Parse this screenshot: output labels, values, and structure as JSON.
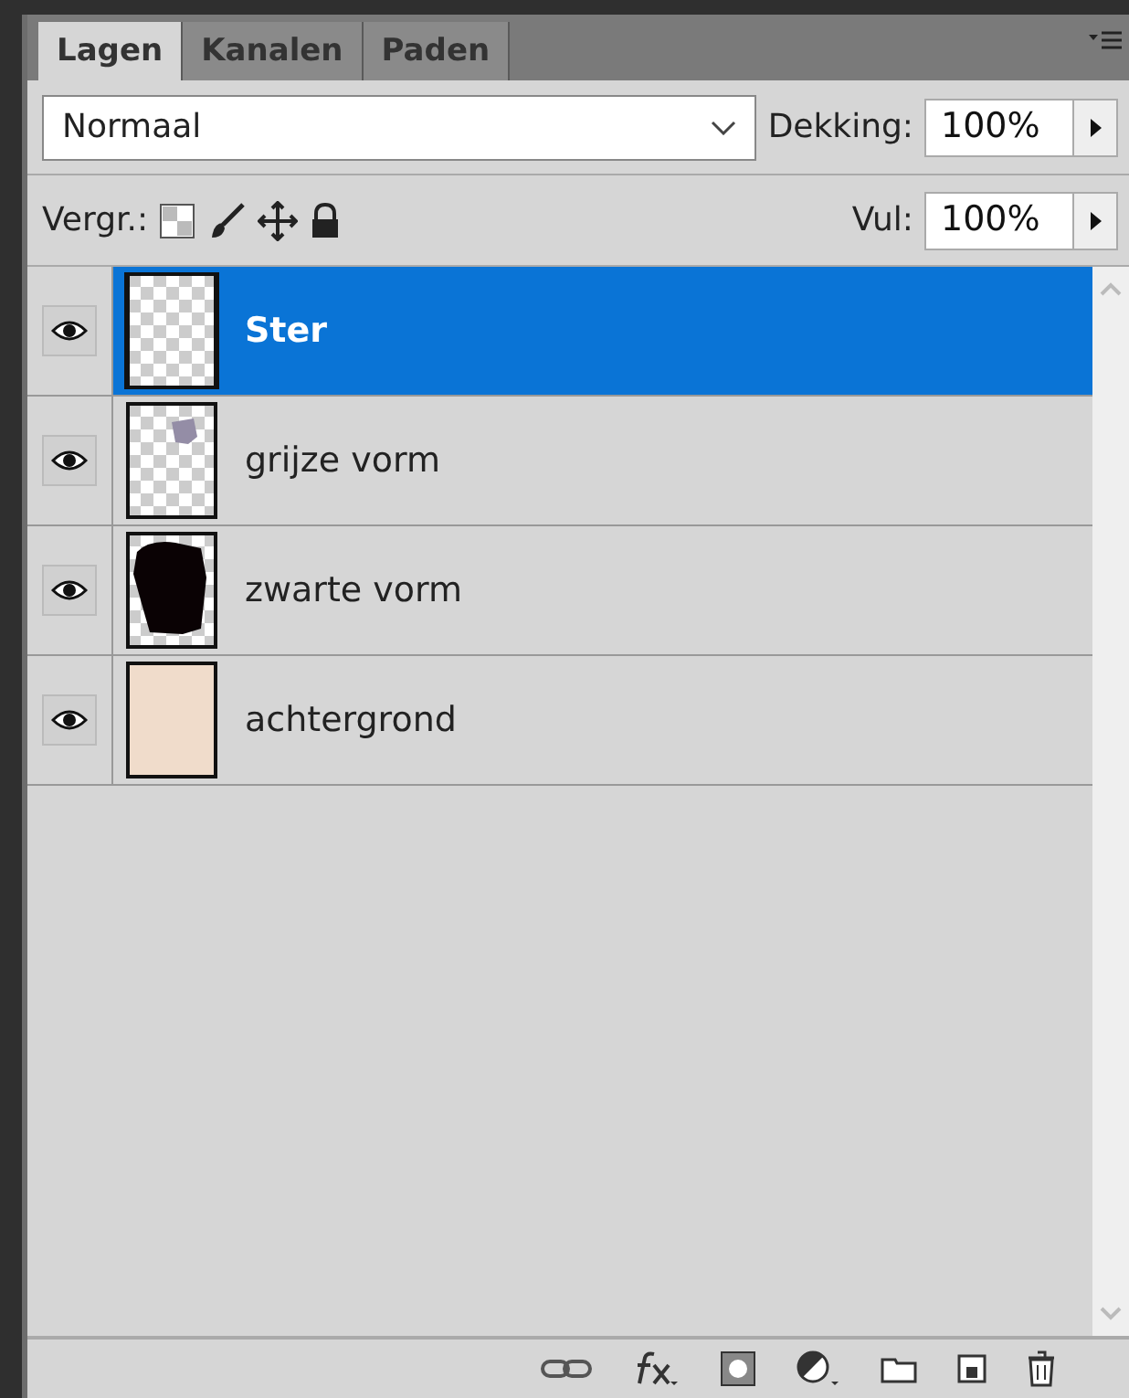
{
  "tabs": [
    {
      "label": "Lagen",
      "selected": true
    },
    {
      "label": "Kanalen",
      "selected": false
    },
    {
      "label": "Paden",
      "selected": false
    }
  ],
  "blend_mode": {
    "value": "Normaal"
  },
  "opacity": {
    "label": "Dekking:",
    "value": "100%"
  },
  "lock": {
    "label": "Vergr.:"
  },
  "fill": {
    "label": "Vul:",
    "value": "100%"
  },
  "layers": [
    {
      "name": "Ster",
      "selected": true,
      "visible": true,
      "thumbnail": {
        "kind": "empty"
      }
    },
    {
      "name": "grijze vorm",
      "selected": false,
      "visible": true,
      "thumbnail": {
        "kind": "grayshape"
      }
    },
    {
      "name": "zwarte vorm",
      "selected": false,
      "visible": true,
      "thumbnail": {
        "kind": "blackshape"
      }
    },
    {
      "name": "achtergrond",
      "selected": false,
      "visible": true,
      "thumbnail": {
        "kind": "fill"
      }
    }
  ]
}
